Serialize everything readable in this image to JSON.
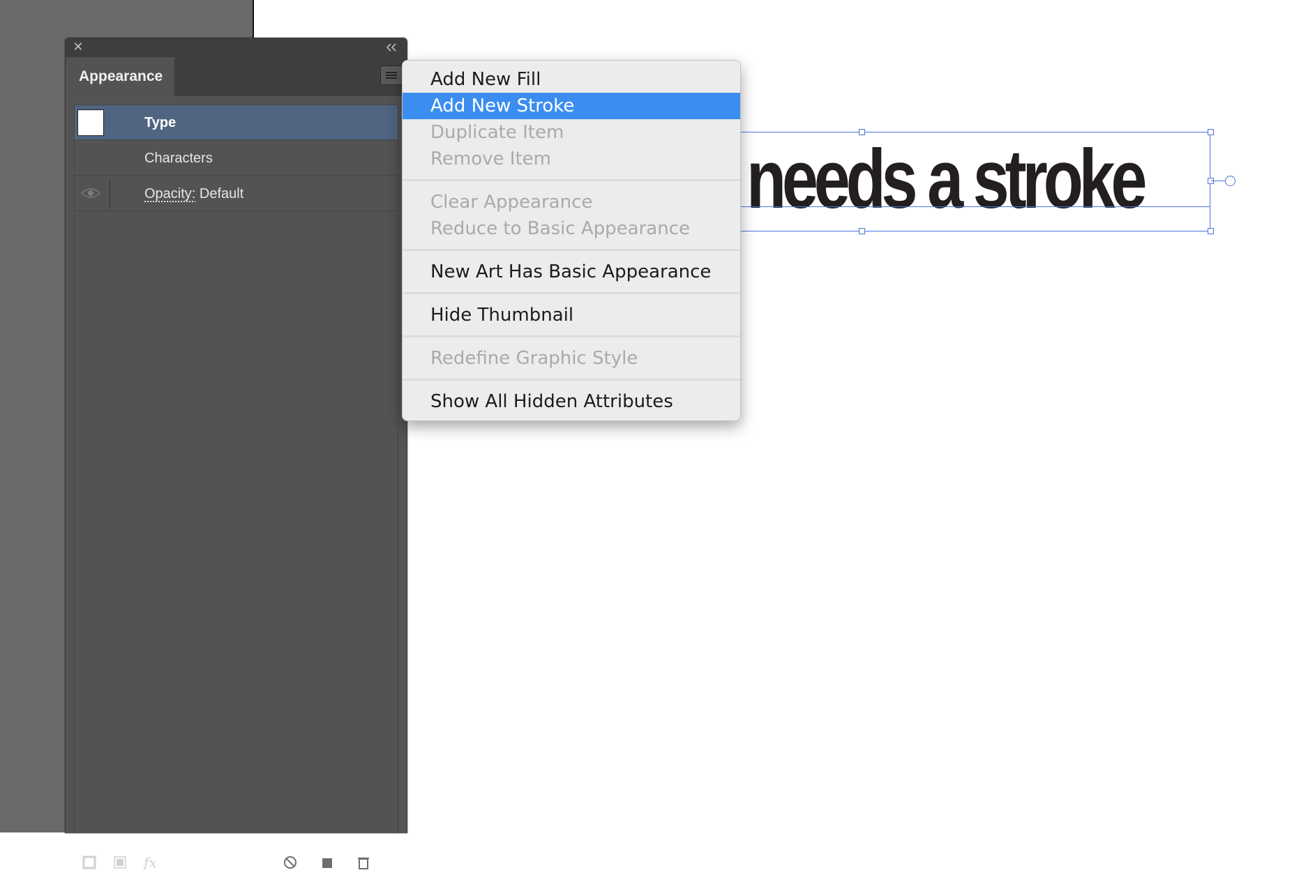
{
  "panel": {
    "title": "Appearance",
    "rows": [
      {
        "label": "Type"
      },
      {
        "label": "Characters"
      },
      {
        "label": "Opacity:",
        "value": "Default"
      }
    ]
  },
  "context_menu": {
    "items": [
      {
        "label": "Add New Fill"
      },
      {
        "label": "Add New Stroke"
      },
      {
        "label": "Duplicate Item"
      },
      {
        "label": "Remove Item"
      },
      {
        "label": "Clear Appearance"
      },
      {
        "label": "Reduce to Basic Appearance"
      },
      {
        "label": "New Art Has Basic Appearance"
      },
      {
        "label": "Hide Thumbnail"
      },
      {
        "label": "Redefine Graphic Style"
      },
      {
        "label": "Show All Hidden Attributes"
      }
    ]
  },
  "canvas": {
    "text_object": "needs a stroke"
  },
  "colors": {
    "highlight": "#3b8ef0",
    "selection": "#4a72d8",
    "panel_bg": "#535353",
    "selected_row": "#4f6581"
  }
}
